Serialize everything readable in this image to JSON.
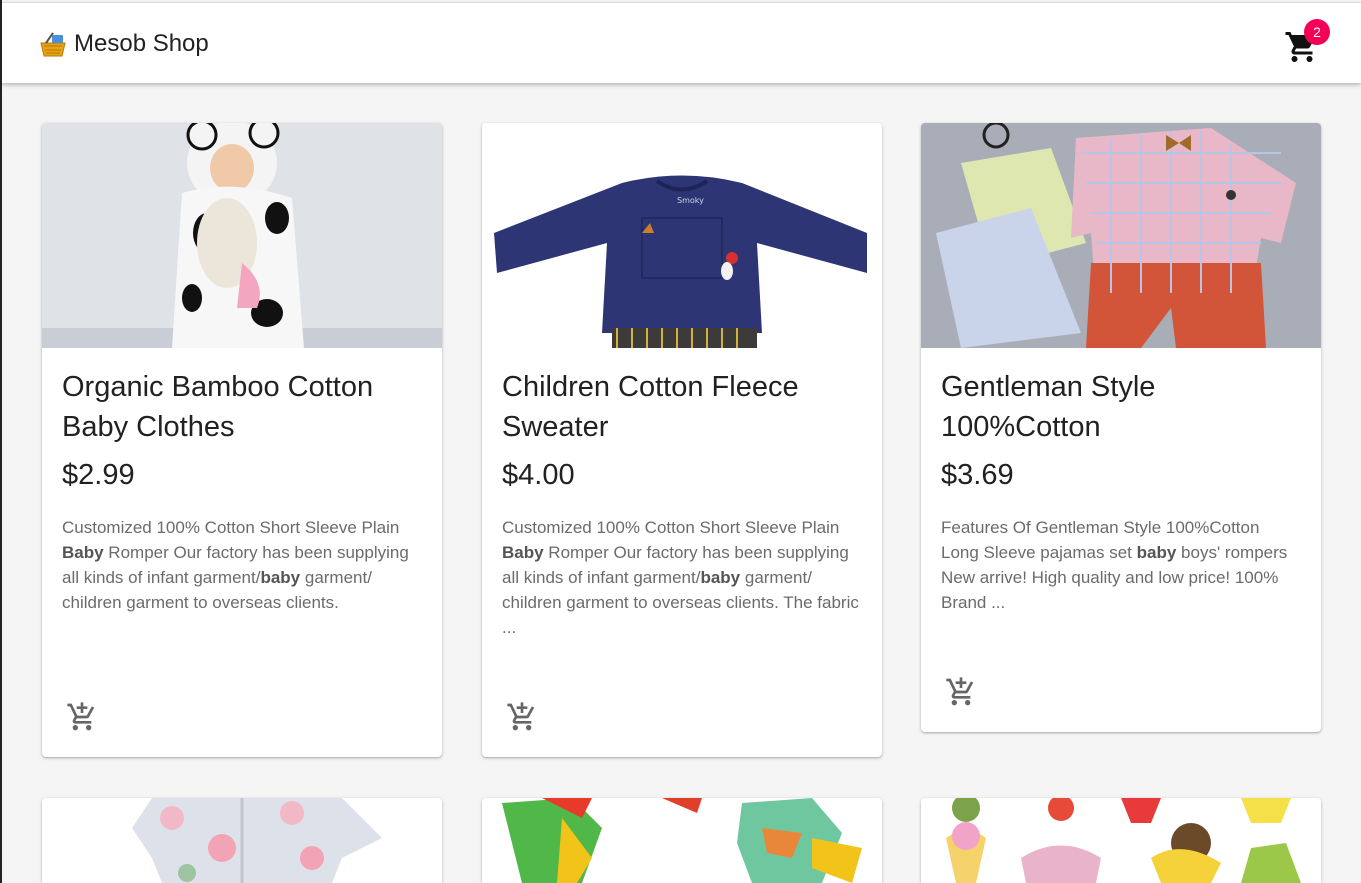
{
  "app": {
    "title": "Mesob Shop",
    "cart_count": "2"
  },
  "icons": {
    "brand": "basket-icon",
    "cart": "shopping-cart-icon",
    "add_to_cart": "add-shopping-cart-icon"
  },
  "colors": {
    "badge": "#f50057",
    "background": "#f5f5f5"
  },
  "products": [
    {
      "title": "Organic Bamboo Cotton Baby Clothes",
      "price": "$2.99",
      "desc": [
        {
          "t": "Customized 100% Cotton Short Sleeve Plain "
        },
        {
          "t": "Baby",
          "b": true
        },
        {
          "t": " Romper Our factory has been supplying all kinds of infant garment/"
        },
        {
          "t": "baby",
          "b": true
        },
        {
          "t": " garment/ children garment to overseas clients."
        }
      ]
    },
    {
      "title": "Children Cotton Fleece Sweater",
      "price": "$4.00",
      "desc": [
        {
          "t": "Customized 100% Cotton Short Sleeve Plain "
        },
        {
          "t": "Baby",
          "b": true
        },
        {
          "t": " Romper Our factory has been supplying all kinds of infant garment/"
        },
        {
          "t": "baby",
          "b": true
        },
        {
          "t": " garment/ children garment to overseas clients. The fabric ..."
        }
      ]
    },
    {
      "title": "Gentleman Style 100%Cotton",
      "price": "$3.69",
      "desc": [
        {
          "t": "Features Of Gentleman Style 100%Cotton Long Sleeve pajamas set "
        },
        {
          "t": "baby",
          "b": true
        },
        {
          "t": " boys' rompers New arrive! High quality and low price! 100% Brand ..."
        }
      ]
    },
    {
      "title": "",
      "price": "",
      "desc": []
    },
    {
      "title": "",
      "price": "",
      "desc": []
    },
    {
      "title": "",
      "price": "",
      "desc": []
    }
  ]
}
